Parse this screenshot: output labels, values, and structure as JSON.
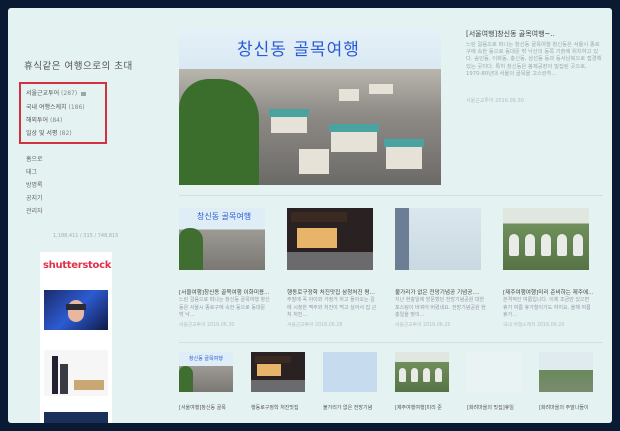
{
  "blog": {
    "title": "휴식같은 여행으로의 초대"
  },
  "categories": [
    {
      "label": "서울근교투어",
      "count": "(287)",
      "new": true
    },
    {
      "label": "국내 여행스케치",
      "count": "(186)",
      "new": false
    },
    {
      "label": "해외투어",
      "count": "(84)",
      "new": false
    },
    {
      "label": "일상 및 서평",
      "count": "(82)",
      "new": false
    }
  ],
  "nav": [
    "홈으로",
    "태그",
    "방명록",
    "공지기",
    "관리자"
  ],
  "counter": "1,188,411 / 315 / 748,815",
  "ad": {
    "brand": "shutterstock"
  },
  "featured": {
    "image_caption": "창신동 골목여행",
    "title": "[서울여행]창신동 골목여행~..",
    "excerpt": "느린 걸음으로 떠나는 창신동 골목여행 창신동은 서울시 종로구에 속한 동으로 동대문 밖 낙산의 동쪽 기슭에 위치하고 있다. 숭인동, 이화동, 충신동, 삼선동 등과 동서남북으로 접경해 있는 곳이다. 특히 창신동은 봉제공장이 밀집된 곳으로, 1970-80년대 서울의 골목을 고스란히...",
    "date": "서울근교투어 2016.06.30"
  },
  "cards": [
    {
      "title": "[서울여행]창신동 골목여행 이화미용...",
      "excerpt": "느린 걸음으로 떠나는 창신동 골목여행 창신동은 서울시 종로구에 속한 동으로 동대문 밖 낙...",
      "date": "서울근교투어 2016.06.30"
    },
    {
      "title": "행동로구정학 처진맛집 삼청처진 평...",
      "excerpt": "주말에 꼭 아이와 가정거 하고 돌아오는 길에 시청한 맥주와 처진이 먹고 싶어서 집 근처 처진...",
      "date": "서울근교투어 2016.06.28"
    },
    {
      "title": "불가리가 없은 전망기념공 기념공....",
      "excerpt": "지난 현충일에 방문했던 전망기념공원 대한 포스팅이 바뀌어 버렸네요. 전망기념공원 현충일을 맞이...",
      "date": "서울근교투어 2016.06.25"
    },
    {
      "title": "[제주여행여행]미리 준비하는 제주에...",
      "excerpt": "본격적인 여름입니다. 이제 조금만 있으면 휴가 여름 휴가철이기도 하지요. 올해 여름휴가...",
      "date": "국내 여행스케치 2016.06.20"
    }
  ],
  "small_cards": [
    {
      "title": "[서울여행]창신동 골목"
    },
    {
      "title": "행동로구정학 처진맛집"
    },
    {
      "title": "불가리가 없은 전망기념"
    },
    {
      "title": "[제주여행여행]미리 준"
    },
    {
      "title": "[화려마을의 맛집]휴일"
    },
    {
      "title": "[화려마을의 주말나들이"
    }
  ]
}
